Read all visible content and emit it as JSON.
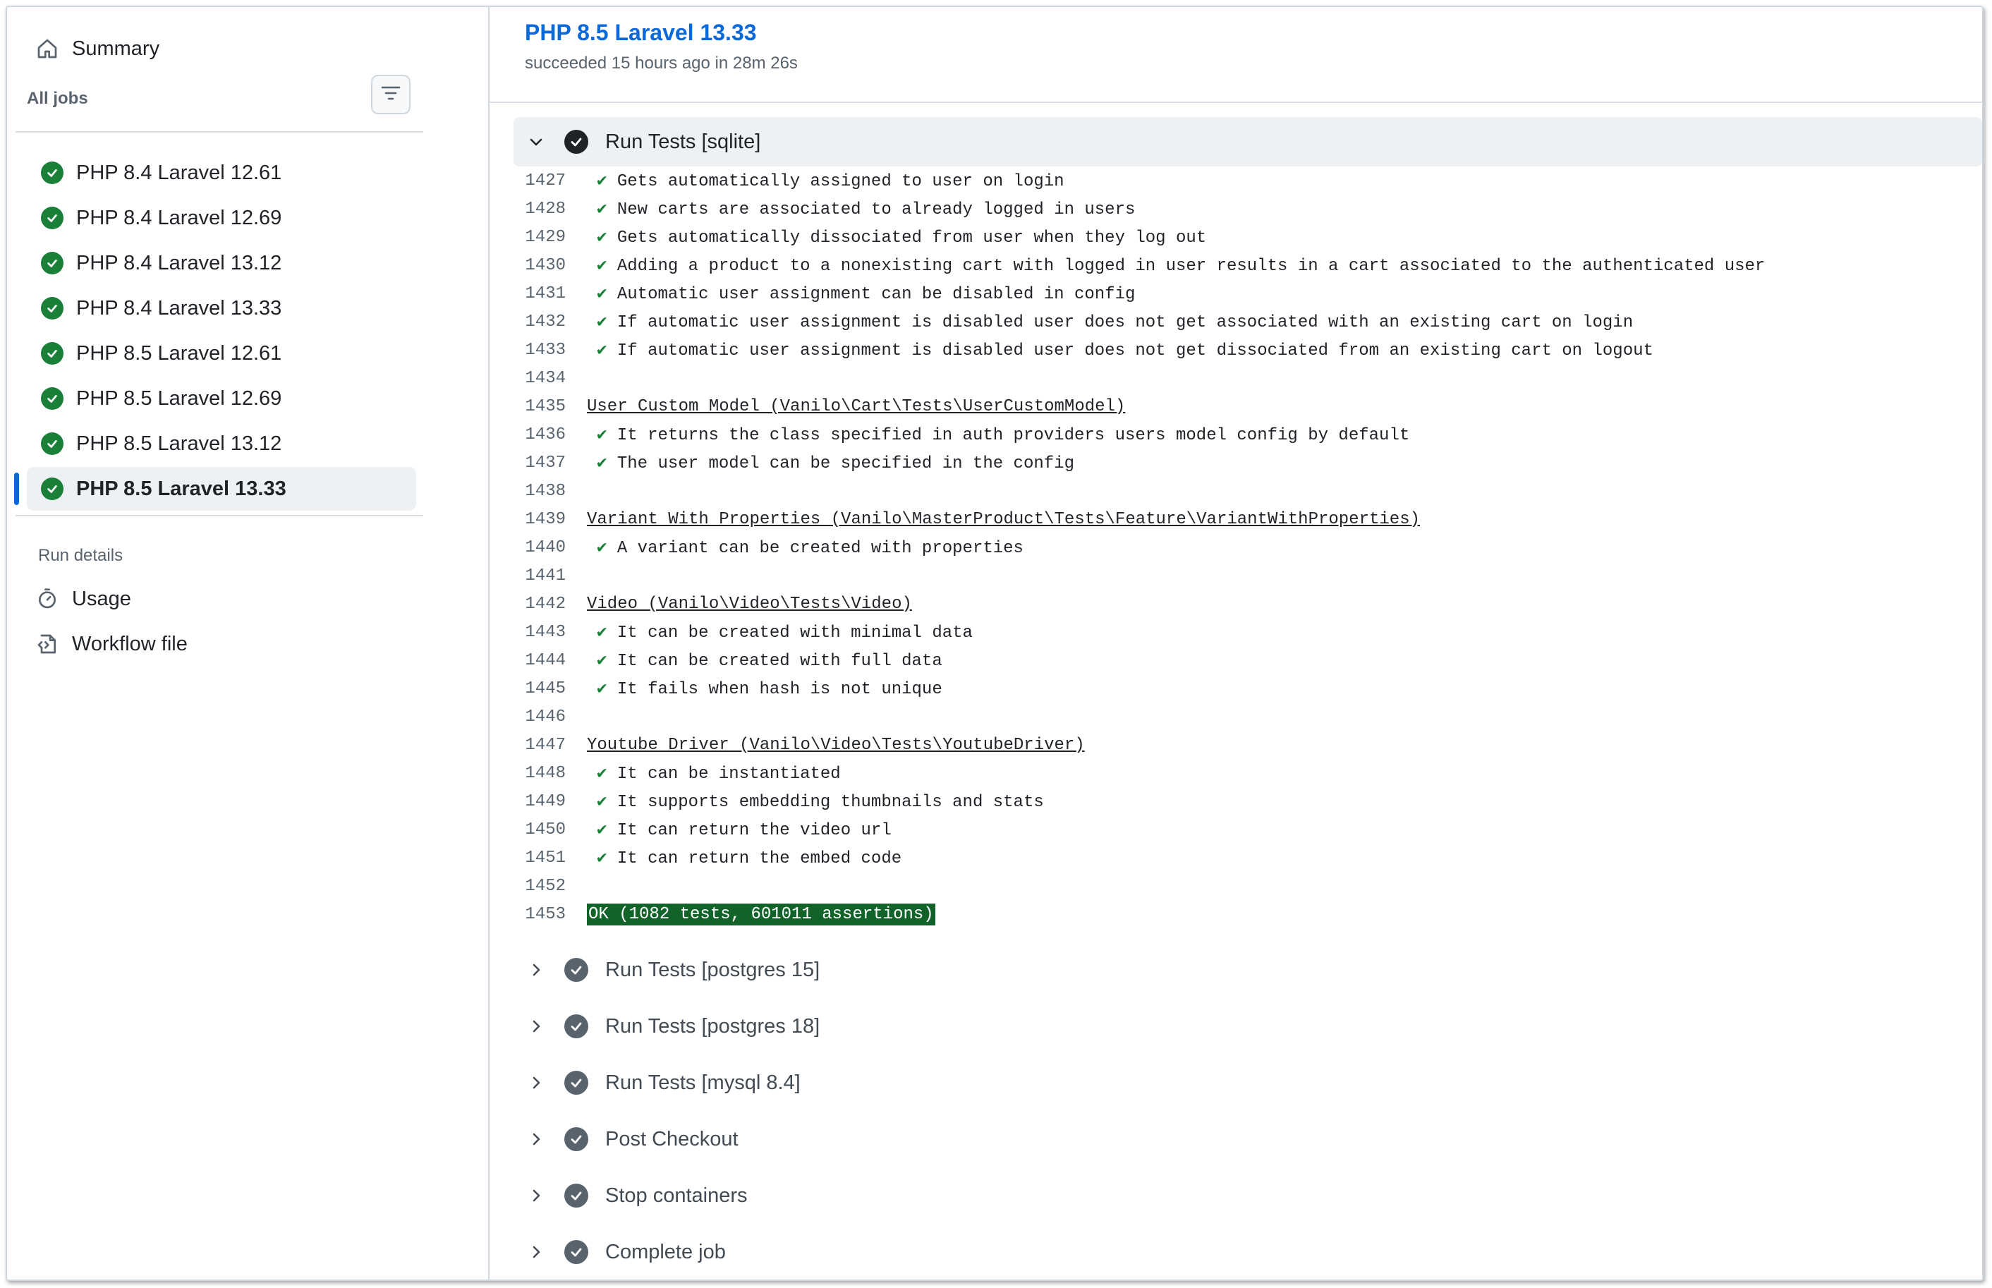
{
  "sidebar": {
    "summary_label": "Summary",
    "all_jobs_label": "All jobs",
    "jobs": [
      {
        "label": "PHP 8.4 Laravel 12.61",
        "selected": false
      },
      {
        "label": "PHP 8.4 Laravel 12.69",
        "selected": false
      },
      {
        "label": "PHP 8.4 Laravel 13.12",
        "selected": false
      },
      {
        "label": "PHP 8.4 Laravel 13.33",
        "selected": false
      },
      {
        "label": "PHP 8.5 Laravel 12.61",
        "selected": false
      },
      {
        "label": "PHP 8.5 Laravel 12.69",
        "selected": false
      },
      {
        "label": "PHP 8.5 Laravel 13.12",
        "selected": false
      },
      {
        "label": "PHP 8.5 Laravel 13.33",
        "selected": true
      }
    ],
    "run_details_label": "Run details",
    "usage_label": "Usage",
    "workflow_file_label": "Workflow file"
  },
  "job": {
    "title": "PHP 8.5 Laravel 13.33",
    "subtitle": "succeeded 15 hours ago in 28m 26s"
  },
  "expanded_step": {
    "label": "Run Tests [sqlite]",
    "lines": [
      {
        "n": "1427",
        "kind": "pass",
        "text": "Gets automatically assigned to user on login"
      },
      {
        "n": "1428",
        "kind": "pass",
        "text": "New carts are associated to already logged in users"
      },
      {
        "n": "1429",
        "kind": "pass",
        "text": "Gets automatically dissociated from user when they log out"
      },
      {
        "n": "1430",
        "kind": "pass",
        "text": "Adding a product to a nonexisting cart with logged in user results in a cart associated to the authenticated user"
      },
      {
        "n": "1431",
        "kind": "pass",
        "text": "Automatic user assignment can be disabled in config"
      },
      {
        "n": "1432",
        "kind": "pass",
        "text": "If automatic user assignment is disabled user does not get associated with an existing cart on login"
      },
      {
        "n": "1433",
        "kind": "pass",
        "text": "If automatic user assignment is disabled user does not get dissociated from an existing cart on logout"
      },
      {
        "n": "1434",
        "kind": "blank",
        "text": ""
      },
      {
        "n": "1435",
        "kind": "heading",
        "text": "User Custom Model (Vanilo\\Cart\\Tests\\UserCustomModel)"
      },
      {
        "n": "1436",
        "kind": "pass",
        "text": "It returns the class specified in auth providers users model config by default"
      },
      {
        "n": "1437",
        "kind": "pass",
        "text": "The user model can be specified in the config"
      },
      {
        "n": "1438",
        "kind": "blank",
        "text": ""
      },
      {
        "n": "1439",
        "kind": "heading",
        "text": "Variant With Properties (Vanilo\\MasterProduct\\Tests\\Feature\\VariantWithProperties)"
      },
      {
        "n": "1440",
        "kind": "pass",
        "text": "A variant can be created with properties"
      },
      {
        "n": "1441",
        "kind": "blank",
        "text": ""
      },
      {
        "n": "1442",
        "kind": "heading",
        "text": "Video (Vanilo\\Video\\Tests\\Video)"
      },
      {
        "n": "1443",
        "kind": "pass",
        "text": "It can be created with minimal data"
      },
      {
        "n": "1444",
        "kind": "pass",
        "text": "It can be created with full data"
      },
      {
        "n": "1445",
        "kind": "pass",
        "text": "It fails when hash is not unique"
      },
      {
        "n": "1446",
        "kind": "blank",
        "text": ""
      },
      {
        "n": "1447",
        "kind": "heading",
        "text": "Youtube Driver (Vanilo\\Video\\Tests\\YoutubeDriver)"
      },
      {
        "n": "1448",
        "kind": "pass",
        "text": "It can be instantiated"
      },
      {
        "n": "1449",
        "kind": "pass",
        "text": "It supports embedding thumbnails and stats"
      },
      {
        "n": "1450",
        "kind": "pass",
        "text": "It can return the video url"
      },
      {
        "n": "1451",
        "kind": "pass",
        "text": "It can return the embed code"
      },
      {
        "n": "1452",
        "kind": "blank",
        "text": ""
      },
      {
        "n": "1453",
        "kind": "ok",
        "text": "OK (1082 tests, 601011 assertions)"
      }
    ]
  },
  "collapsed_steps": [
    {
      "label": "Run Tests [postgres 15]"
    },
    {
      "label": "Run Tests [postgres 18]"
    },
    {
      "label": "Run Tests [mysql 8.4]"
    },
    {
      "label": "Post Checkout"
    },
    {
      "label": "Stop containers"
    },
    {
      "label": "Complete job"
    }
  ],
  "colors": {
    "success_green": "#1a7f37",
    "link_blue": "#0969da",
    "ok_background": "#116329"
  }
}
